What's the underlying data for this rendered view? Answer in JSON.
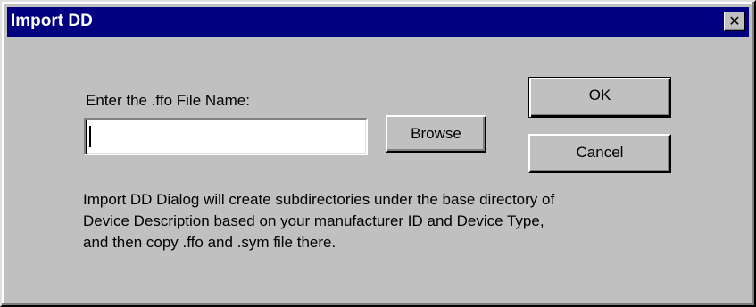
{
  "window": {
    "title": "Import DD",
    "close_glyph": "✕"
  },
  "form": {
    "file_label": "Enter the .ffo File Name:",
    "file_value": "",
    "browse_label": "Browse"
  },
  "actions": {
    "ok_label": "OK",
    "cancel_label": "Cancel"
  },
  "description": {
    "lines": [
      "Import DD Dialog will create subdirectories under the base directory of",
      "Device Description based on your manufacturer ID and Device Type,",
      "and then copy .ffo and .sym file there."
    ]
  },
  "colors": {
    "titlebar": "#000080",
    "face": "#c0c0c0"
  }
}
